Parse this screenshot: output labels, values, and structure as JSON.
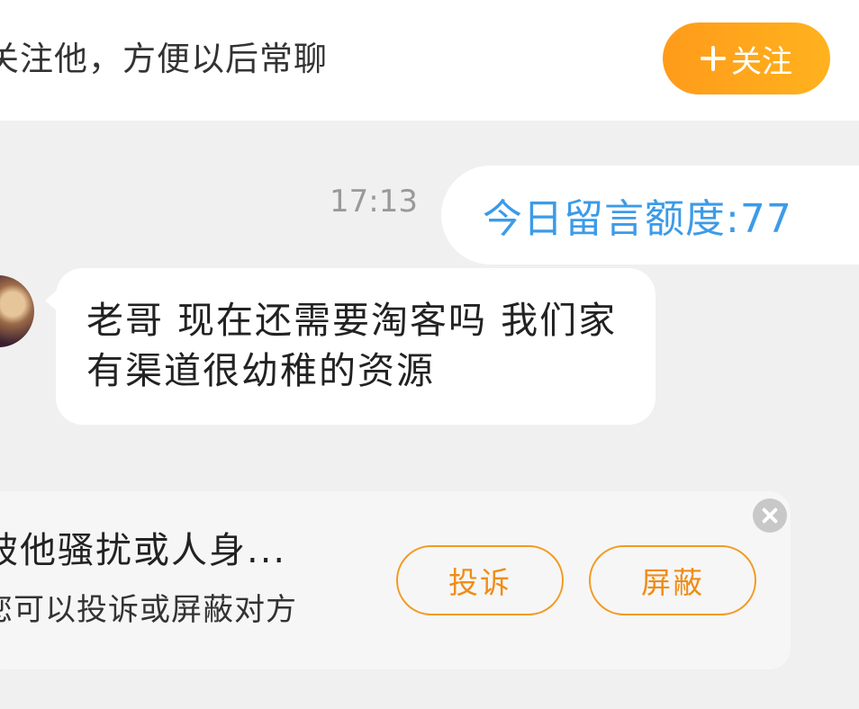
{
  "follow_bar": {
    "hint": "关注他，方便以后常聊",
    "button_label": "关注",
    "button_icon": "plus-icon"
  },
  "messages": [
    {
      "direction": "sent",
      "time": "17:13",
      "text": "今日留言额度:77",
      "text_color": "#3c9be8"
    },
    {
      "direction": "received",
      "text": "老哥 现在还需要淘客吗  我们家有渠道很幼稚的资源"
    }
  ],
  "report_card": {
    "title": "被他骚扰或人身...",
    "subtitle": "您可以投诉或屏蔽对方",
    "complain_label": "投诉",
    "block_label": "屏蔽",
    "close_icon": "close-icon"
  },
  "colors": {
    "accent_orange": "#ff9b1a",
    "link_blue": "#3c9be8",
    "background": "#f0f0f0"
  }
}
